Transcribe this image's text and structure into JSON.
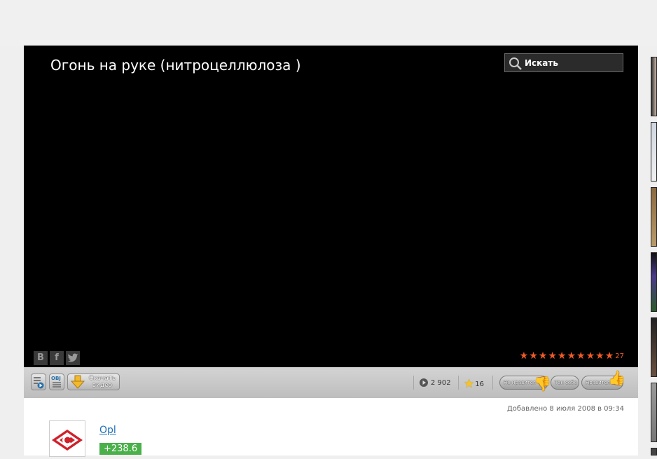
{
  "video": {
    "title": "Огонь на руке (нитроцеллюлоза )"
  },
  "search": {
    "placeholder": "Искать",
    "icon": "search-icon"
  },
  "share": {
    "vk_label": "B",
    "facebook_label": "f"
  },
  "stars": {
    "count_of_ten": 10,
    "rating_count": "27",
    "color": "#ef5a28"
  },
  "controls": {
    "download_label_line1": "Скачать",
    "download_label_line2": "видео",
    "embed_label": "OBJ"
  },
  "stats": {
    "views": "2 902",
    "favorites": "16"
  },
  "voting": {
    "dislike": "Не нравится",
    "meh": "Так себе",
    "like": "Нравится"
  },
  "meta": {
    "added": "Добавлено 8 июля 2008 в 09:34"
  },
  "author": {
    "name": "Opl",
    "rating": "+238.6",
    "rating_color": "#49b04a"
  }
}
